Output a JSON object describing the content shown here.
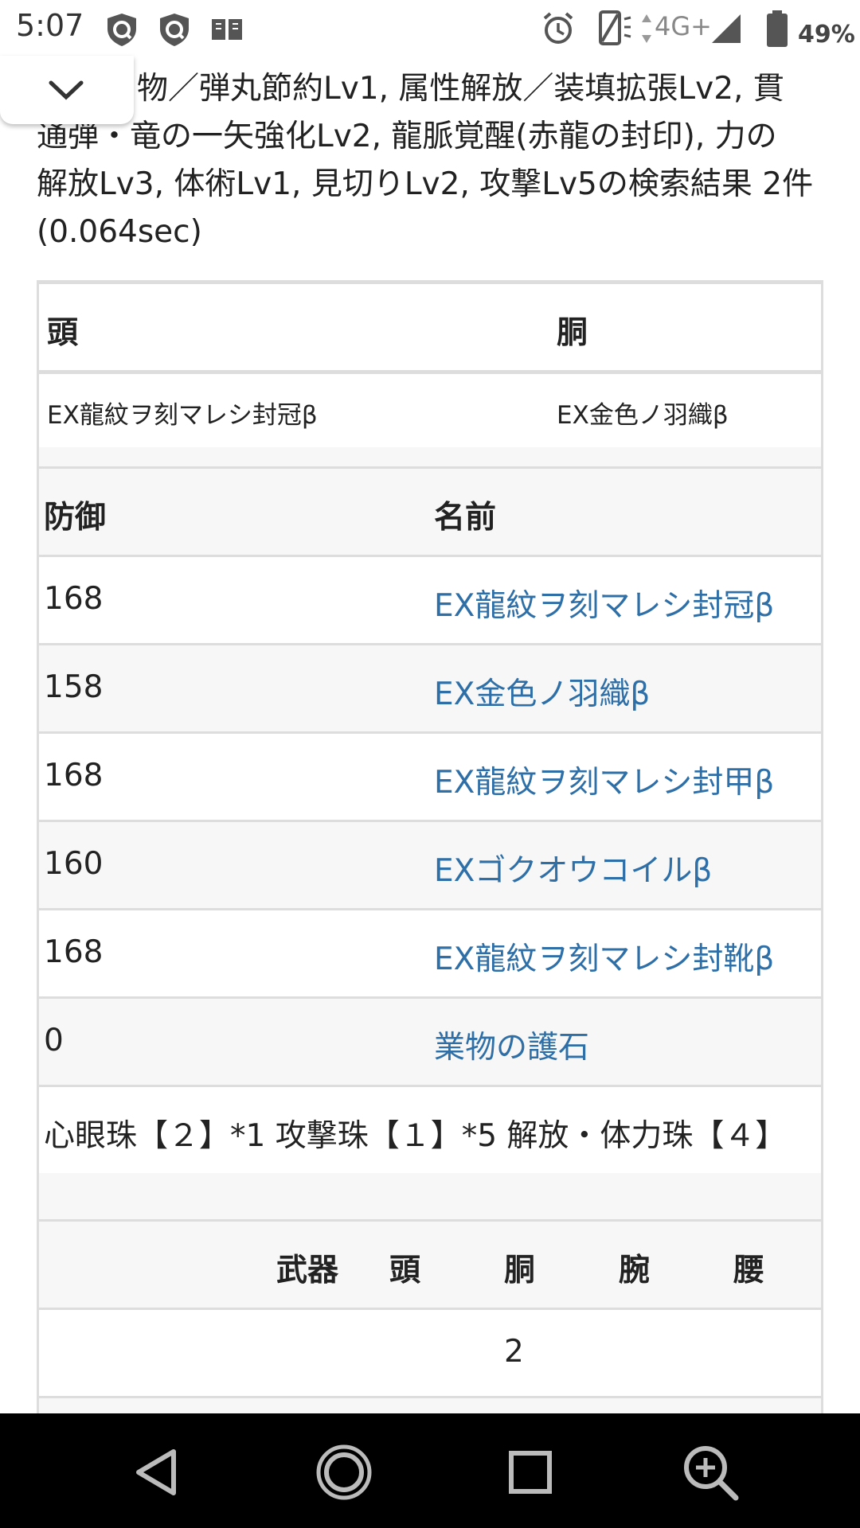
{
  "status_bar": {
    "time": "5:07",
    "network": "4G+",
    "battery": "49%",
    "icons_left": [
      "shield-icon",
      "shield-icon",
      "reader-icon"
    ],
    "icons_right": [
      "alarm-icon",
      "vibrate-icon",
      "data-arrows-icon",
      "signal-icon",
      "battery-icon"
    ]
  },
  "collapse_button": {
    "icon": "chevron-down-icon"
  },
  "search_summary": {
    "line1": "物／弾丸節約Lv1, 属性解放／装填拡張Lv2, 貫",
    "line2": "通弾・竜の一矢強化Lv2, 龍脈覚醒(赤龍の封印), 力の",
    "line3": "解放Lv3, 体術Lv1, 見切りLv2, 攻撃Lv5の検索結果 2件",
    "line4": "(0.064sec)"
  },
  "summary_table": {
    "headers": [
      "頭",
      "胴"
    ],
    "values": [
      "EX龍紋ヲ刻マレシ封冠β",
      "EX金色ノ羽織β"
    ]
  },
  "detail_table": {
    "headers": [
      "防御",
      "名前"
    ],
    "rows": [
      {
        "defense": "168",
        "name": "EX龍紋ヲ刻マレシ封冠β"
      },
      {
        "defense": "158",
        "name": "EX金色ノ羽織β"
      },
      {
        "defense": "168",
        "name": "EX龍紋ヲ刻マレシ封甲β"
      },
      {
        "defense": "160",
        "name": "EXゴクオウコイルβ"
      },
      {
        "defense": "168",
        "name": "EX龍紋ヲ刻マレシ封靴β"
      },
      {
        "defense": "0",
        "name": "業物の護石"
      }
    ],
    "decorations": "心眼珠【２】*1 攻撃珠【１】*5 解放・体力珠【４】"
  },
  "slot_table": {
    "headers": [
      "武器",
      "頭",
      "胴",
      "腕",
      "腰"
    ],
    "row1_value": "2"
  },
  "nav_bar": {
    "icons": [
      "back-icon",
      "home-icon",
      "recents-icon",
      "zoom-in-icon"
    ]
  }
}
